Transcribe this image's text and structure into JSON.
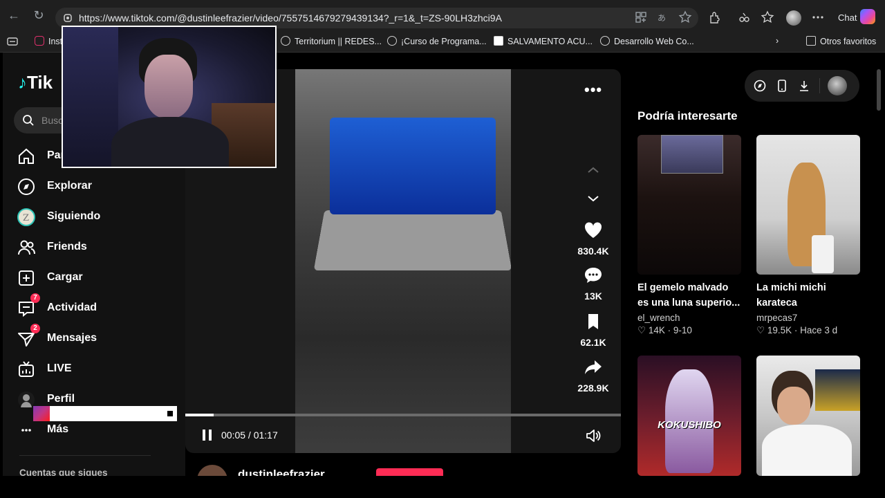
{
  "browser": {
    "url": "https://www.tiktok.com/@dustinleefrazier/video/7557514679279439134?_r=1&_t=ZS-90LH3zhci9A",
    "chat_label": "Chat",
    "bookmarks": [
      {
        "label": "Inst",
        "icon": "instagram-icon"
      },
      {
        "label": "Territorium || REDES...",
        "icon": "globe-icon"
      },
      {
        "label": "¡Curso de Programa...",
        "icon": "globe-icon"
      },
      {
        "label": "SALVAMENTO ACU...",
        "icon": "s-logo-icon"
      },
      {
        "label": "Desarrollo Web Co...",
        "icon": "globe-icon"
      }
    ],
    "other_bookmarks": "Otros favoritos"
  },
  "sidebar": {
    "logo": "Tik",
    "search_placeholder": "Busc",
    "items": [
      {
        "label": "Par",
        "icon": "home-icon"
      },
      {
        "label": "Explorar",
        "icon": "compass-icon"
      },
      {
        "label": "Siguiendo",
        "icon": "following-avatar-icon"
      },
      {
        "label": "Friends",
        "icon": "friends-icon"
      },
      {
        "label": "Cargar",
        "icon": "upload-icon"
      },
      {
        "label": "Actividad",
        "icon": "activity-icon",
        "badge": "7"
      },
      {
        "label": "Mensajes",
        "icon": "messages-icon",
        "badge": "2"
      },
      {
        "label": "LIVE",
        "icon": "live-icon"
      },
      {
        "label": "Perfil",
        "icon": "profile-avatar-icon"
      },
      {
        "label": "Más",
        "icon": "more-icon"
      }
    ],
    "following_accounts": "Cuentas que sigues"
  },
  "video": {
    "likes": "830.4K",
    "comments": "13K",
    "saves": "62.1K",
    "shares": "228.9K",
    "time": "00:05 / 01:17",
    "progress": 0.065,
    "author": "dustinleefrazier"
  },
  "recommendations": {
    "title": "Podría interesarte",
    "cards": [
      {
        "title": "El gemelo malvado es una luna superio...",
        "author": "el_wrench",
        "likes": "14K",
        "meta": "9-10"
      },
      {
        "title": "La michi michi karateca",
        "author": "mrpecas7",
        "likes": "19.5K",
        "meta": "Hace 3 d"
      },
      {
        "overlay": "KOKUSHIBO"
      },
      {}
    ]
  },
  "colors": {
    "accent": "#fe2c55",
    "background": "#121212"
  }
}
